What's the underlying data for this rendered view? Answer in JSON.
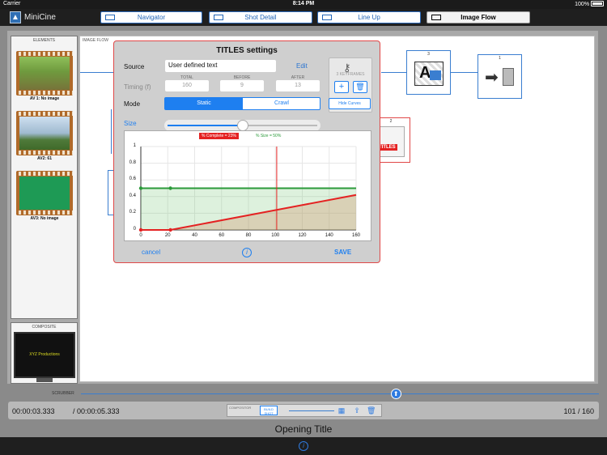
{
  "status_bar": {
    "carrier": "Carrier",
    "time": "8:14 PM",
    "battery": "100%"
  },
  "app": {
    "name": "MiniCine"
  },
  "nav_tabs": [
    {
      "label": "Navigator",
      "icon": "grid-icon"
    },
    {
      "label": "Shot Detail",
      "icon": "play-icon"
    },
    {
      "label": "Line Up",
      "icon": "lineup-icon"
    },
    {
      "label": "Image Flow",
      "icon": "flow-icon",
      "active": true
    }
  ],
  "elements_panel": {
    "title": "ELEMENTS",
    "items": [
      {
        "caption": "AV 1: No image"
      },
      {
        "caption": "AV2: 61"
      },
      {
        "caption": "AV3: No image"
      }
    ]
  },
  "composite_panel": {
    "title": "COMPOSITE",
    "preview_text": "XYZ Productions"
  },
  "image_flow": {
    "label": "IMAGE FLOW",
    "nodes": [
      {
        "number": "3",
        "icon": "text-image-icon"
      },
      {
        "number": "1",
        "icon": "output-arrow-icon"
      },
      {
        "number": "2",
        "badge": "TITLES"
      }
    ]
  },
  "titles_dialog": {
    "title": "TITLES settings",
    "source_label": "Source",
    "source_value": "User defined text",
    "edit_label": "Edit",
    "timing_label": "Timing (f)",
    "timing_headers": [
      "TOTAL",
      "BEFORE",
      "AFTER"
    ],
    "timing_values": [
      "160",
      "9",
      "13"
    ],
    "mode_label": "Mode",
    "mode_options": [
      "Static",
      "Crawl"
    ],
    "mode_selected": "Static",
    "size_label": "Size",
    "size_slider_value": 0.5,
    "keyframes_label": "3 KEYFRAMES",
    "add_keyframe": "+",
    "hide_curves_label": "Hide Curves",
    "cancel_label": "cancel",
    "info_label": "i",
    "save_label": "SAVE"
  },
  "chart_data": {
    "type": "line",
    "legend": [
      "% Complete = 23%",
      "% Size = 50%"
    ],
    "x_ticks": [
      "0",
      "20",
      "40",
      "60",
      "80",
      "100",
      "120",
      "140",
      "160"
    ],
    "y_ticks": [
      "1",
      "0.8",
      "0.6",
      "0.4",
      "0.2",
      "0"
    ],
    "xlim": [
      0,
      160
    ],
    "ylim": [
      0,
      1
    ],
    "current_frame": 101,
    "series": [
      {
        "name": "% Complete",
        "color": "#e42222",
        "x": [
          0,
          22,
          160
        ],
        "y": [
          0,
          0,
          0.42
        ]
      },
      {
        "name": "% Size",
        "color": "#2b9a3a",
        "x": [
          0,
          22,
          160
        ],
        "y": [
          0.5,
          0.5,
          0.5
        ]
      }
    ]
  },
  "scrubber": {
    "label": "SCRUBBER",
    "position": 0.609
  },
  "timebar": {
    "current_time": "00:00:03.333",
    "total_time": "/ 00:00:05.333",
    "compositor_label": "COMPOSITOR",
    "build_shot_label": "BUILD SHOT",
    "frame_count": "101 / 160"
  },
  "shot_title": "Opening Title",
  "colors": {
    "accent": "#1e7ff0",
    "red": "#e42222",
    "green": "#2b9a3a"
  }
}
